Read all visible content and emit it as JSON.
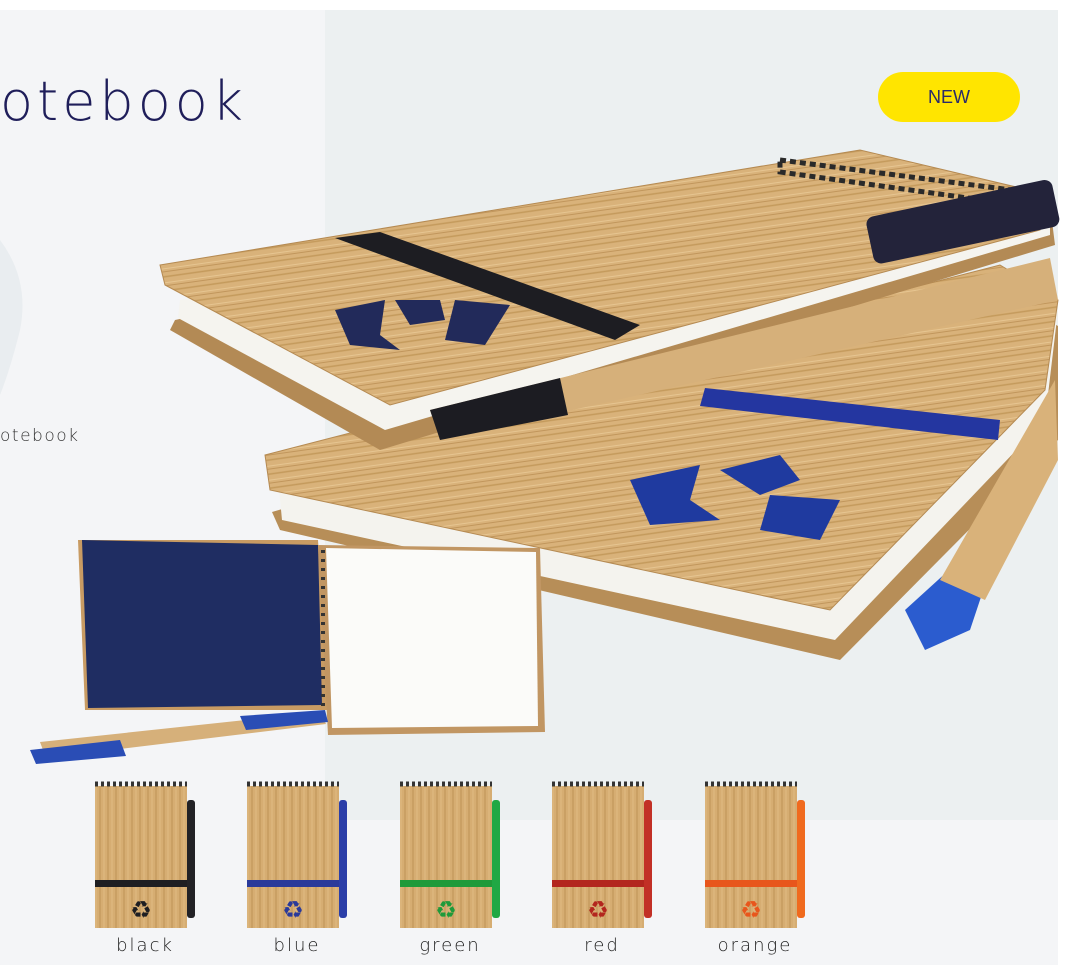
{
  "header": {
    "title": "otebook",
    "subtitle": "otebook"
  },
  "badge": {
    "label": "NEW",
    "color": "#ffe500"
  },
  "product_photo": {
    "icon": "recycle-icon"
  },
  "colors": [
    {
      "label": "black",
      "band": "#1e1e22",
      "pen": "#222226"
    },
    {
      "label": "blue",
      "band": "#2a3a9a",
      "pen": "#2b3ea8"
    },
    {
      "label": "green",
      "band": "#1f9a3a",
      "pen": "#20a844"
    },
    {
      "label": "red",
      "band": "#b3261e",
      "pen": "#c23026"
    },
    {
      "label": "orange",
      "band": "#e8561c",
      "pen": "#f06a1e"
    }
  ]
}
